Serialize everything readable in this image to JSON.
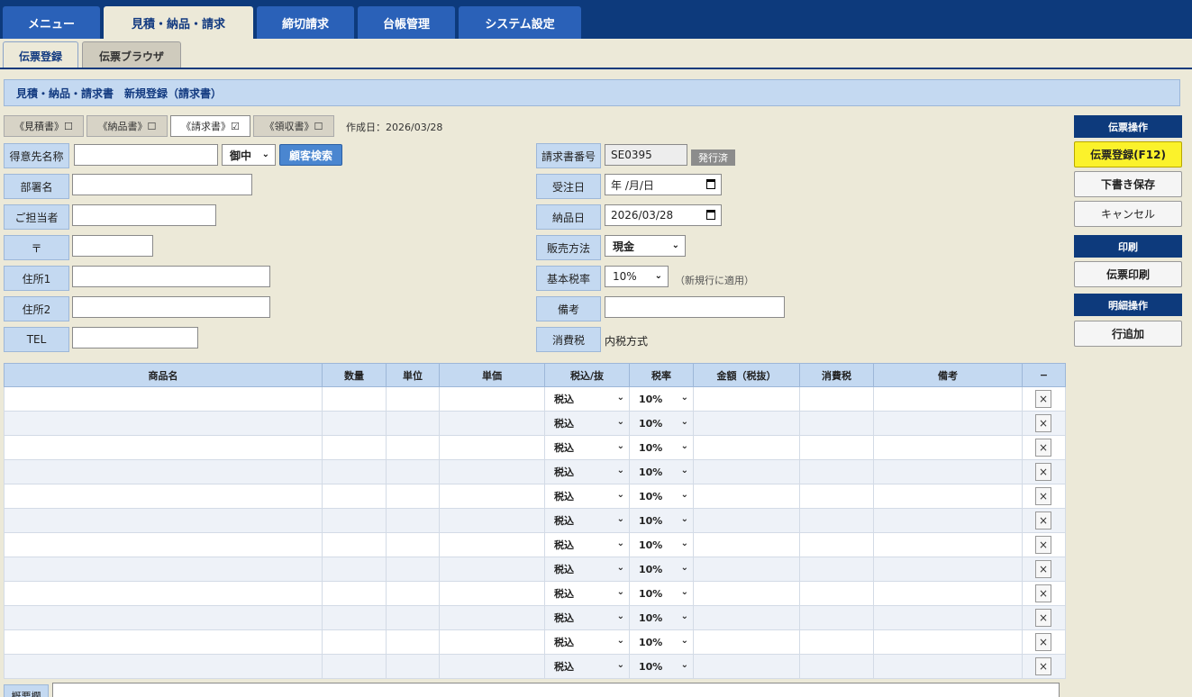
{
  "topnav": {
    "tabs": [
      {
        "label": "メニュー",
        "active": false
      },
      {
        "label": "見積・納品・請求",
        "active": true
      },
      {
        "label": "締切請求",
        "active": false
      },
      {
        "label": "台帳管理",
        "active": false
      },
      {
        "label": "システム設定",
        "active": false
      }
    ]
  },
  "subtabs": [
    {
      "label": "伝票登録",
      "active": true
    },
    {
      "label": "伝票ブラウザ",
      "active": false
    }
  ],
  "banner": {
    "title": "見積・納品・請求書　新規登録（請求書）"
  },
  "doctabs": [
    {
      "label": "《見積書》☐",
      "active": false
    },
    {
      "label": "《納品書》☐",
      "active": false
    },
    {
      "label": "《請求書》☑",
      "active": true
    },
    {
      "label": "《領収書》☐",
      "active": false
    }
  ],
  "created": "作成日：2026/03/28",
  "left_form": {
    "customer_label": "得意先名称",
    "customer_value": "",
    "honorific": "御中",
    "search_button": "顧客検索",
    "dept_label": "部署名",
    "contact_label": "ご担当者",
    "zip_label": "〒",
    "addr1_label": "住所1",
    "addr2_label": "住所2",
    "tel_label": "TEL"
  },
  "right_form": {
    "invoice_no_label": "請求書番号",
    "invoice_no": "SE0395",
    "issued_badge": "発行済",
    "order_date_label": "受注日",
    "order_date": "年 /月/日",
    "delivery_date_label": "納品日",
    "delivery_date": "2026/03/28",
    "sales_method_label": "販売方法",
    "sales_method": "現金",
    "tax_rate_label": "基本税率",
    "tax_rate": "10%",
    "tax_rate_note": "（新規行に適用）",
    "remarks_label": "備考",
    "consumption_tax_label": "消費税",
    "consumption_tax": "内税方式"
  },
  "panel": {
    "doc_ops_header": "伝票操作",
    "register_button": "伝票登録(F12)",
    "draft_button": "下書き保存",
    "cancel_button": "キャンセル",
    "print_header": "印刷",
    "print_button": "伝票印刷",
    "detail_header": "明細操作",
    "add_row_button": "行追加"
  },
  "table": {
    "headers": [
      "商品名",
      "数量",
      "単位",
      "単価",
      "税込/抜",
      "税率",
      "金額（税抜）",
      "消費税",
      "備考",
      "−"
    ],
    "rows": [
      {
        "tax_type": "税込",
        "rate": "10%"
      },
      {
        "tax_type": "税込",
        "rate": "10%"
      },
      {
        "tax_type": "税込",
        "rate": "10%"
      },
      {
        "tax_type": "税込",
        "rate": "10%"
      },
      {
        "tax_type": "税込",
        "rate": "10%"
      },
      {
        "tax_type": "税込",
        "rate": "10%"
      },
      {
        "tax_type": "税込",
        "rate": "10%"
      },
      {
        "tax_type": "税込",
        "rate": "10%"
      },
      {
        "tax_type": "税込",
        "rate": "10%"
      },
      {
        "tax_type": "税込",
        "rate": "10%"
      },
      {
        "tax_type": "税込",
        "rate": "10%"
      },
      {
        "tax_type": "税込",
        "rate": "10%"
      }
    ],
    "delete_glyph": "×"
  },
  "footer": {
    "summary_label": "概要欄"
  }
}
